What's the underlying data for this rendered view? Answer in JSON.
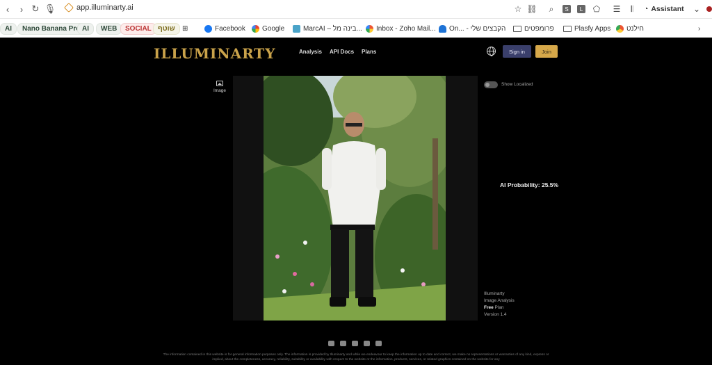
{
  "browser": {
    "url": "app.illuminarty.ai",
    "assistant_label": "Assistant",
    "ext_s": "S",
    "ext_l": "L",
    "bookmarks": [
      {
        "label": "AI"
      },
      {
        "label": "Nano Banana Pro"
      },
      {
        "label": "AI"
      },
      {
        "label": "WEB"
      },
      {
        "label": "SOCIAL"
      },
      {
        "label": "שוטף"
      },
      {
        "label": "Facebook"
      },
      {
        "label": "Google"
      },
      {
        "label": "MarcAI – בינה מל..."
      },
      {
        "label": "Inbox - Zoho Mail..."
      },
      {
        "label": "On... - הקבצים שלי"
      },
      {
        "label": "פרומפטים"
      },
      {
        "label": "Plasfy Apps"
      },
      {
        "label": "חילנט"
      }
    ]
  },
  "header": {
    "logo": "ILLUMINARTY",
    "nav": [
      "Analysis",
      "API Docs",
      "Plans"
    ],
    "signin": "Sign in",
    "join": "Join"
  },
  "sidebar": {
    "image_label": "Image"
  },
  "controls": {
    "show_localized": "Show Localized"
  },
  "result": {
    "ai_probability": "AI Probability: 25.5%"
  },
  "info": {
    "line1": "Illuminarty",
    "line2": "Image Analysis",
    "plan_bold": "Free",
    "plan_rest": " Plan",
    "version": "Version 1.4"
  },
  "footer": {
    "disclaimer": "The information contained in this website is for general information purposes only. The information is provided by Illuminarty and while we endeavour to keep the information up to date and correct, we make no representations or warranties of any kind, express or implied, about the completeness, accuracy, reliability, suitability or availability with respect to the website or the information, products, services, or related graphics contained on the website for any"
  },
  "colors": {
    "logo_gold": "#c9a24a",
    "signin_bg": "#3a3f6b",
    "join_bg": "#d6a84a"
  }
}
